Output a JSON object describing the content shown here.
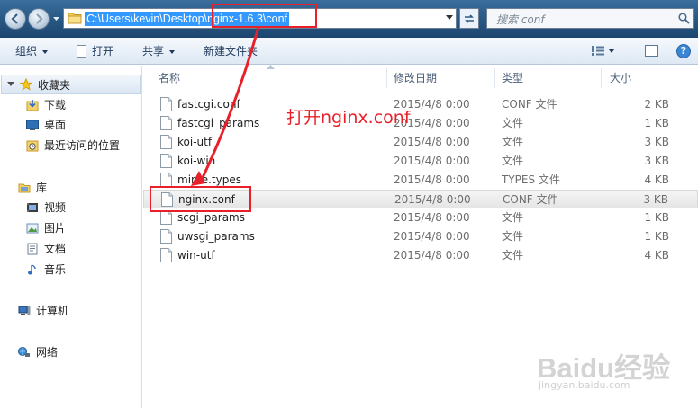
{
  "address_bar": {
    "path": "C:\\Users\\kevin\\Desktop\\nginx-1.6.3\\conf",
    "search_placeholder": "搜索 conf"
  },
  "toolbar": {
    "organize": "组织",
    "open": "打开",
    "share": "共享",
    "new_folder": "新建文件夹"
  },
  "nav": {
    "favorites": "收藏夹",
    "downloads": "下载",
    "desktop": "桌面",
    "recent": "最近访问的位置",
    "libraries": "库",
    "videos": "视频",
    "pictures": "图片",
    "documents": "文档",
    "music": "音乐",
    "computer": "计算机",
    "network": "网络"
  },
  "columns": {
    "name": "名称",
    "date": "修改日期",
    "type": "类型",
    "size": "大小"
  },
  "files": [
    {
      "name": "fastcgi.conf",
      "date": "2015/4/8 0:00",
      "type": "CONF 文件",
      "size": "2 KB"
    },
    {
      "name": "fastcgi_params",
      "date": "2015/4/8 0:00",
      "type": "文件",
      "size": "1 KB"
    },
    {
      "name": "koi-utf",
      "date": "2015/4/8 0:00",
      "type": "文件",
      "size": "3 KB"
    },
    {
      "name": "koi-win",
      "date": "2015/4/8 0:00",
      "type": "文件",
      "size": "3 KB"
    },
    {
      "name": "mime.types",
      "date": "2015/4/8 0:00",
      "type": "TYPES 文件",
      "size": "4 KB"
    },
    {
      "name": "nginx.conf",
      "date": "2015/4/8 0:00",
      "type": "CONF 文件",
      "size": "3 KB"
    },
    {
      "name": "scgi_params",
      "date": "2015/4/8 0:00",
      "type": "文件",
      "size": "1 KB"
    },
    {
      "name": "uwsgi_params",
      "date": "2015/4/8 0:00",
      "type": "文件",
      "size": "1 KB"
    },
    {
      "name": "win-utf",
      "date": "2015/4/8 0:00",
      "type": "文件",
      "size": "4 KB"
    }
  ],
  "annotation": {
    "text": "打开nginx.conf",
    "color": "#e8202a"
  },
  "watermark": {
    "main": "Baidu经验",
    "sub": "jingyan.baidu.com"
  },
  "colors": {
    "selection": "#3399ff",
    "titlebar": "#2a5a86"
  }
}
